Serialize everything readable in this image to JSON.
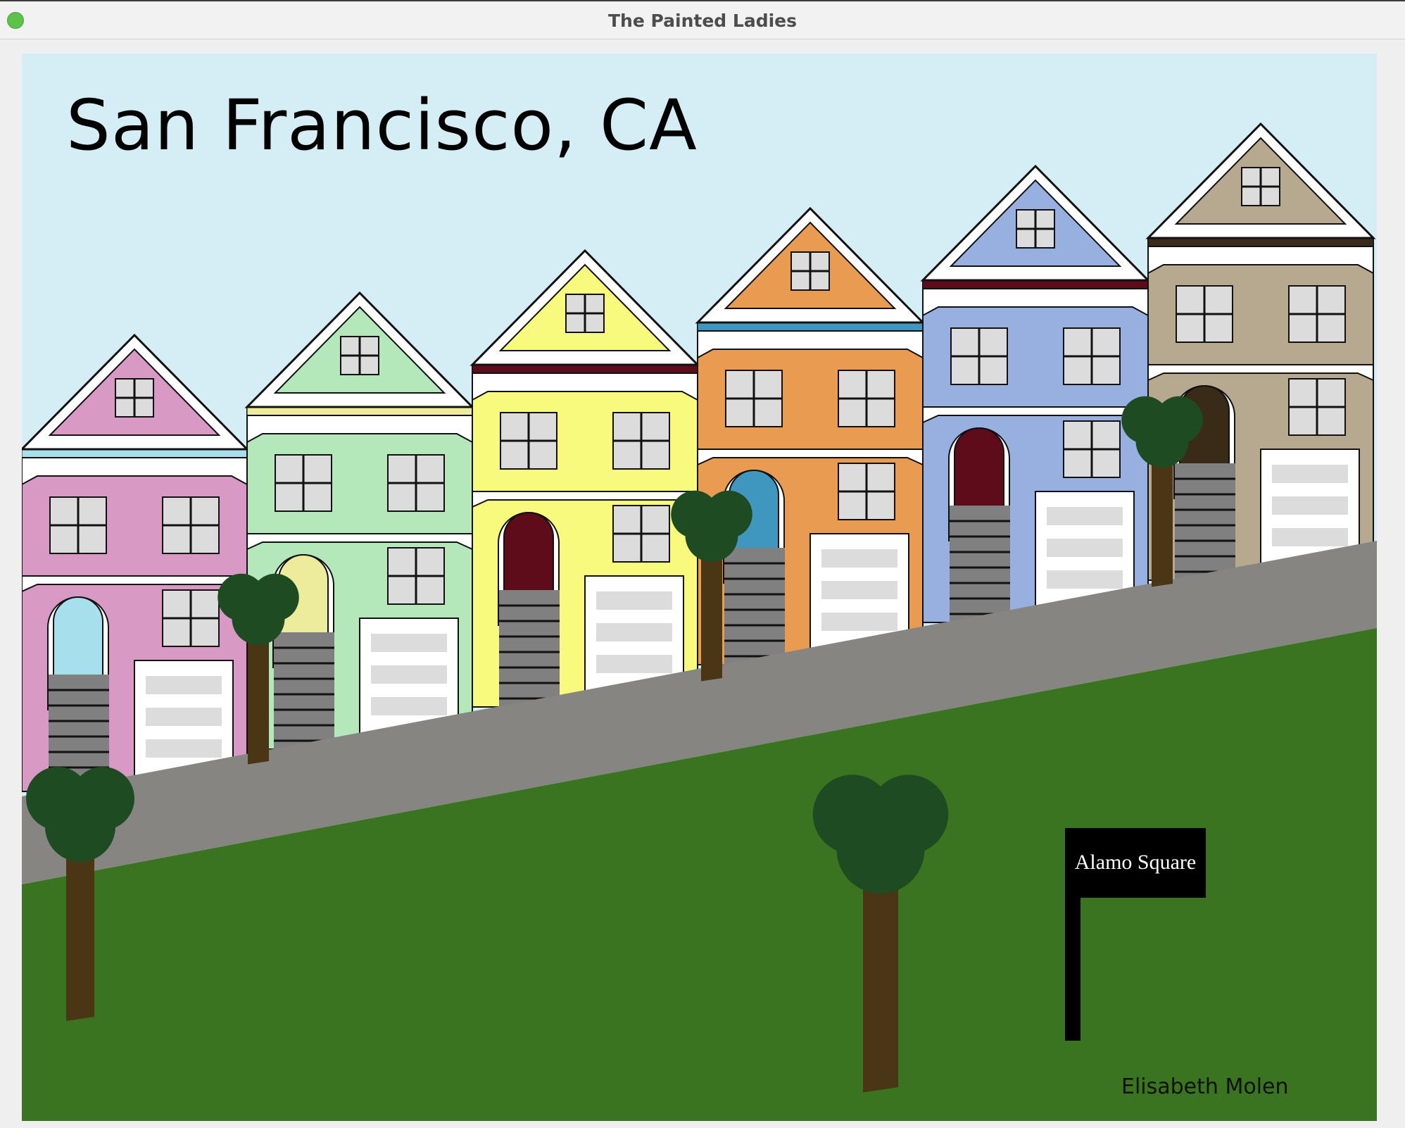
{
  "window": {
    "title": "The Painted Ladies",
    "close_button_color": "#5dc14a"
  },
  "scene": {
    "heading": "San Francisco, CA",
    "sign_text": "Alamo Square",
    "credit": "Elisabeth Molen",
    "colors": {
      "sky": "#d5edf4",
      "grass": "#3b7421",
      "street": "#878581",
      "tree_foliage": "#1f4b23",
      "tree_trunk": "#4a3614",
      "window_glass": "#dcdcdc",
      "stairs": "#808080",
      "sign": "#000000"
    },
    "houses": [
      {
        "name": "pink-house",
        "body": "#d899c5",
        "trim": "#a7e0ec",
        "door": "#a7e0ec",
        "band": "#ffffff"
      },
      {
        "name": "green-house",
        "body": "#b4e8ba",
        "trim": "#ecec9c",
        "door": "#ecec9c",
        "band": "#ffffff"
      },
      {
        "name": "yellow-house",
        "body": "#f8fa7d",
        "trim": "#5e0b1a",
        "door": "#5e0b1a",
        "band": "#5e0b1a"
      },
      {
        "name": "orange-house",
        "body": "#e99b52",
        "trim": "#3f97bf",
        "door": "#3f97bf",
        "band": "#3f97bf"
      },
      {
        "name": "blue-house",
        "body": "#98b0e0",
        "trim": "#5e0b1a",
        "door": "#5e0b1a",
        "band": "#5e0b1a"
      },
      {
        "name": "tan-house",
        "body": "#b7a98f",
        "trim": "#3a2a18",
        "door": "#3a2a18",
        "band": "#3a2a18"
      }
    ]
  }
}
